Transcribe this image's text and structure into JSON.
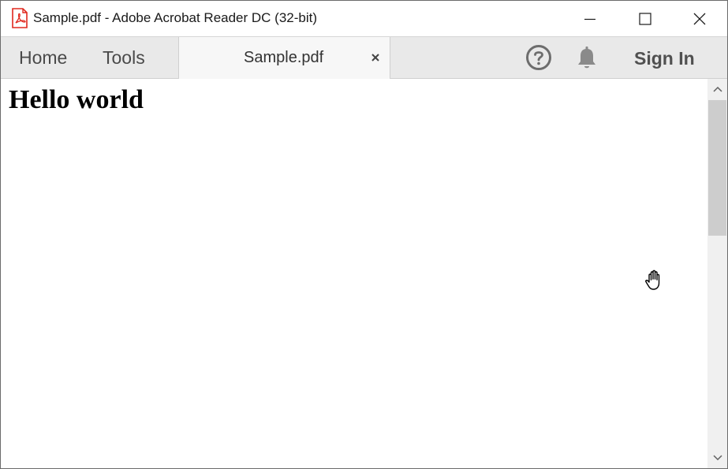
{
  "window": {
    "title": "Sample.pdf - Adobe Acrobat Reader DC (32-bit)",
    "app_icon": "acrobat-pdf-icon",
    "controls": [
      "minimize-icon",
      "maximize-icon",
      "close-icon"
    ]
  },
  "tabbar": {
    "nav": [
      {
        "label": "Home"
      },
      {
        "label": "Tools"
      }
    ],
    "document_tab": {
      "label": "Sample.pdf",
      "close_glyph": "×"
    },
    "help_icon": "help-question-icon",
    "notifications_icon": "bell-icon",
    "sign_in_label": "Sign In"
  },
  "document": {
    "heading": "Hello world"
  },
  "cursor": "hand-cursor-icon",
  "colors": {
    "acrobat_red": "#e0281e",
    "tabbar_bg": "#e9e9e9",
    "active_tab_bg": "#f7f7f7",
    "scrollbar_thumb": "#cdcdcd"
  }
}
